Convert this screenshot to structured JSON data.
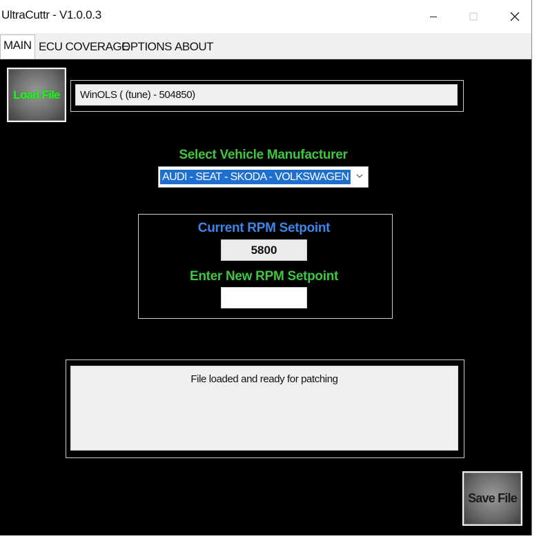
{
  "window": {
    "title": "UltraCuttr - V1.0.0.3"
  },
  "tabs": [
    {
      "label": "MAIN",
      "active": true
    },
    {
      "label": "ECU COVERAGE",
      "active": false
    },
    {
      "label": "OPTIONS",
      "active": false
    },
    {
      "label": "ABOUT",
      "active": false
    }
  ],
  "main": {
    "load_button_label": "Load File",
    "file_name_value": "WinOLS ( (tune) - 504850)",
    "manufacturer": {
      "label": "Select Vehicle Manufacturer",
      "selected": "AUDI - SEAT - SKODA - VOLKSWAGEN"
    },
    "rpm": {
      "current_label": "Current RPM Setpoint",
      "current_value": "5800",
      "new_label": "Enter New RPM Setpoint",
      "new_value": ""
    },
    "status_text": "File loaded and ready for patching",
    "save_button_label": "Save File"
  },
  "icons": {
    "minimize": "minimize-icon",
    "maximize": "maximize-icon",
    "close": "close-icon",
    "dropdown": "chevron-down-icon"
  },
  "colors": {
    "background": "#000000",
    "green_label": "#3ec63e",
    "blue_label": "#3d86e8",
    "load_text": "#37e337",
    "selection": "#1e6fd0"
  }
}
